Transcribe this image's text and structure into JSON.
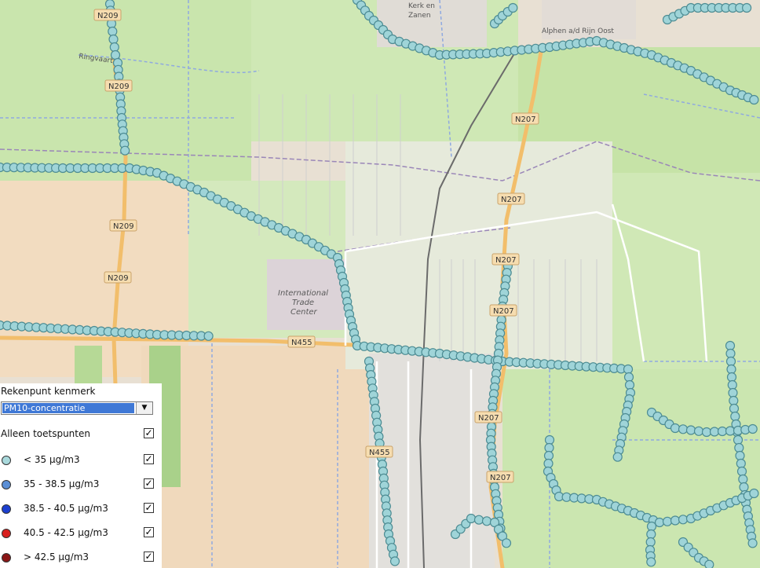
{
  "map": {
    "road_labels": [
      "N209",
      "N209",
      "N209",
      "N209",
      "N207",
      "N207",
      "N207",
      "N207",
      "N207",
      "N455",
      "N455",
      "N207"
    ],
    "place_labels": {
      "kerk_en_zanen": "Kerk en\nZanen",
      "alphen_oost": "Alphen a/d Rijn Oost",
      "itc": "International\nTrade\nCenter",
      "ringvaart": "Ringvaart"
    },
    "point_color": "#9fd4d8",
    "point_stroke": "#4d8c93"
  },
  "panel": {
    "title": "Rekenpunt kenmerk",
    "select": {
      "value": "PM10-concentratie"
    },
    "only_test_points": {
      "label": "Alleen toetspunten",
      "checked": true
    },
    "legend": [
      {
        "label": "< 35 µg/m3",
        "color": "#a9d9dc",
        "checked": true
      },
      {
        "label": "35 - 38.5 µg/m3",
        "color": "#5b8fd6",
        "checked": true
      },
      {
        "label": "38.5 - 40.5 µg/m3",
        "color": "#1c3fd0",
        "checked": true
      },
      {
        "label": "40.5 - 42.5 µg/m3",
        "color": "#d8201e",
        "checked": true
      },
      {
        "label": "> 42.5 µg/m3",
        "color": "#8a1616",
        "checked": true
      }
    ]
  }
}
